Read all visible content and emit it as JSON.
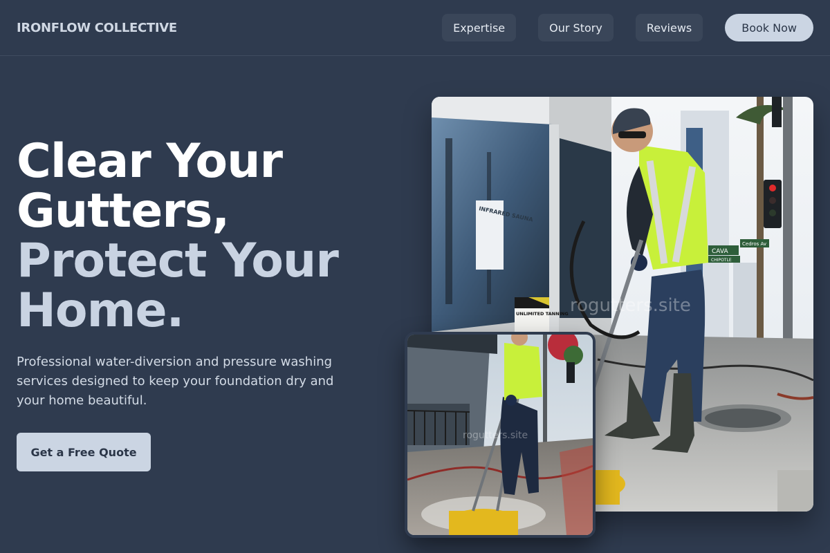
{
  "header": {
    "brand": "IRONFLOW COLLECTIVE",
    "nav": [
      "Expertise",
      "Our Story",
      "Reviews"
    ],
    "cta": "Book Now"
  },
  "hero": {
    "title_line1": "Clear Your",
    "title_line2": "Gutters,",
    "title_line3": "Protect Your",
    "title_line4": "Home.",
    "subtitle": "Professional water-diversion and pressure washing services designed to keep your foundation dry and your home beautiful.",
    "cta": "Get a Free Quote"
  },
  "images": {
    "main_signs": [
      "CAVA",
      "CHIPOTLE",
      "Cedros Av",
      "INFRARED SAUNA",
      "UNLIMITED TANNING"
    ],
    "watermark": "rogutters.site"
  },
  "colors": {
    "background": "#2f3b4f",
    "accent": "#cbd5e3",
    "vest": "#c8f03a"
  }
}
